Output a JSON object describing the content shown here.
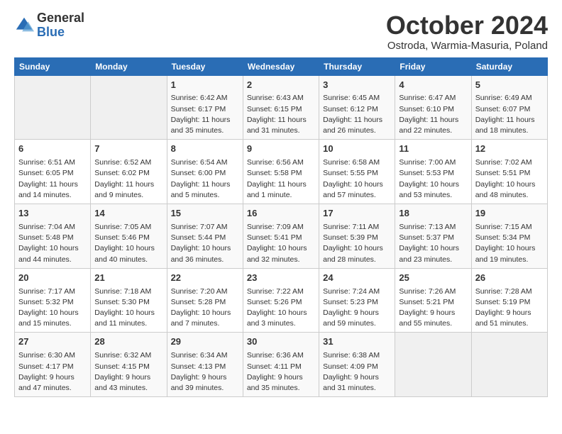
{
  "header": {
    "logo_general": "General",
    "logo_blue": "Blue",
    "month_title": "October 2024",
    "subtitle": "Ostroda, Warmia-Masuria, Poland"
  },
  "days_of_week": [
    "Sunday",
    "Monday",
    "Tuesday",
    "Wednesday",
    "Thursday",
    "Friday",
    "Saturday"
  ],
  "weeks": [
    [
      {
        "num": "",
        "info": ""
      },
      {
        "num": "",
        "info": ""
      },
      {
        "num": "1",
        "info": "Sunrise: 6:42 AM\nSunset: 6:17 PM\nDaylight: 11 hours\nand 35 minutes."
      },
      {
        "num": "2",
        "info": "Sunrise: 6:43 AM\nSunset: 6:15 PM\nDaylight: 11 hours\nand 31 minutes."
      },
      {
        "num": "3",
        "info": "Sunrise: 6:45 AM\nSunset: 6:12 PM\nDaylight: 11 hours\nand 26 minutes."
      },
      {
        "num": "4",
        "info": "Sunrise: 6:47 AM\nSunset: 6:10 PM\nDaylight: 11 hours\nand 22 minutes."
      },
      {
        "num": "5",
        "info": "Sunrise: 6:49 AM\nSunset: 6:07 PM\nDaylight: 11 hours\nand 18 minutes."
      }
    ],
    [
      {
        "num": "6",
        "info": "Sunrise: 6:51 AM\nSunset: 6:05 PM\nDaylight: 11 hours\nand 14 minutes."
      },
      {
        "num": "7",
        "info": "Sunrise: 6:52 AM\nSunset: 6:02 PM\nDaylight: 11 hours\nand 9 minutes."
      },
      {
        "num": "8",
        "info": "Sunrise: 6:54 AM\nSunset: 6:00 PM\nDaylight: 11 hours\nand 5 minutes."
      },
      {
        "num": "9",
        "info": "Sunrise: 6:56 AM\nSunset: 5:58 PM\nDaylight: 11 hours\nand 1 minute."
      },
      {
        "num": "10",
        "info": "Sunrise: 6:58 AM\nSunset: 5:55 PM\nDaylight: 10 hours\nand 57 minutes."
      },
      {
        "num": "11",
        "info": "Sunrise: 7:00 AM\nSunset: 5:53 PM\nDaylight: 10 hours\nand 53 minutes."
      },
      {
        "num": "12",
        "info": "Sunrise: 7:02 AM\nSunset: 5:51 PM\nDaylight: 10 hours\nand 48 minutes."
      }
    ],
    [
      {
        "num": "13",
        "info": "Sunrise: 7:04 AM\nSunset: 5:48 PM\nDaylight: 10 hours\nand 44 minutes."
      },
      {
        "num": "14",
        "info": "Sunrise: 7:05 AM\nSunset: 5:46 PM\nDaylight: 10 hours\nand 40 minutes."
      },
      {
        "num": "15",
        "info": "Sunrise: 7:07 AM\nSunset: 5:44 PM\nDaylight: 10 hours\nand 36 minutes."
      },
      {
        "num": "16",
        "info": "Sunrise: 7:09 AM\nSunset: 5:41 PM\nDaylight: 10 hours\nand 32 minutes."
      },
      {
        "num": "17",
        "info": "Sunrise: 7:11 AM\nSunset: 5:39 PM\nDaylight: 10 hours\nand 28 minutes."
      },
      {
        "num": "18",
        "info": "Sunrise: 7:13 AM\nSunset: 5:37 PM\nDaylight: 10 hours\nand 23 minutes."
      },
      {
        "num": "19",
        "info": "Sunrise: 7:15 AM\nSunset: 5:34 PM\nDaylight: 10 hours\nand 19 minutes."
      }
    ],
    [
      {
        "num": "20",
        "info": "Sunrise: 7:17 AM\nSunset: 5:32 PM\nDaylight: 10 hours\nand 15 minutes."
      },
      {
        "num": "21",
        "info": "Sunrise: 7:18 AM\nSunset: 5:30 PM\nDaylight: 10 hours\nand 11 minutes."
      },
      {
        "num": "22",
        "info": "Sunrise: 7:20 AM\nSunset: 5:28 PM\nDaylight: 10 hours\nand 7 minutes."
      },
      {
        "num": "23",
        "info": "Sunrise: 7:22 AM\nSunset: 5:26 PM\nDaylight: 10 hours\nand 3 minutes."
      },
      {
        "num": "24",
        "info": "Sunrise: 7:24 AM\nSunset: 5:23 PM\nDaylight: 9 hours\nand 59 minutes."
      },
      {
        "num": "25",
        "info": "Sunrise: 7:26 AM\nSunset: 5:21 PM\nDaylight: 9 hours\nand 55 minutes."
      },
      {
        "num": "26",
        "info": "Sunrise: 7:28 AM\nSunset: 5:19 PM\nDaylight: 9 hours\nand 51 minutes."
      }
    ],
    [
      {
        "num": "27",
        "info": "Sunrise: 6:30 AM\nSunset: 4:17 PM\nDaylight: 9 hours\nand 47 minutes."
      },
      {
        "num": "28",
        "info": "Sunrise: 6:32 AM\nSunset: 4:15 PM\nDaylight: 9 hours\nand 43 minutes."
      },
      {
        "num": "29",
        "info": "Sunrise: 6:34 AM\nSunset: 4:13 PM\nDaylight: 9 hours\nand 39 minutes."
      },
      {
        "num": "30",
        "info": "Sunrise: 6:36 AM\nSunset: 4:11 PM\nDaylight: 9 hours\nand 35 minutes."
      },
      {
        "num": "31",
        "info": "Sunrise: 6:38 AM\nSunset: 4:09 PM\nDaylight: 9 hours\nand 31 minutes."
      },
      {
        "num": "",
        "info": ""
      },
      {
        "num": "",
        "info": ""
      }
    ]
  ]
}
